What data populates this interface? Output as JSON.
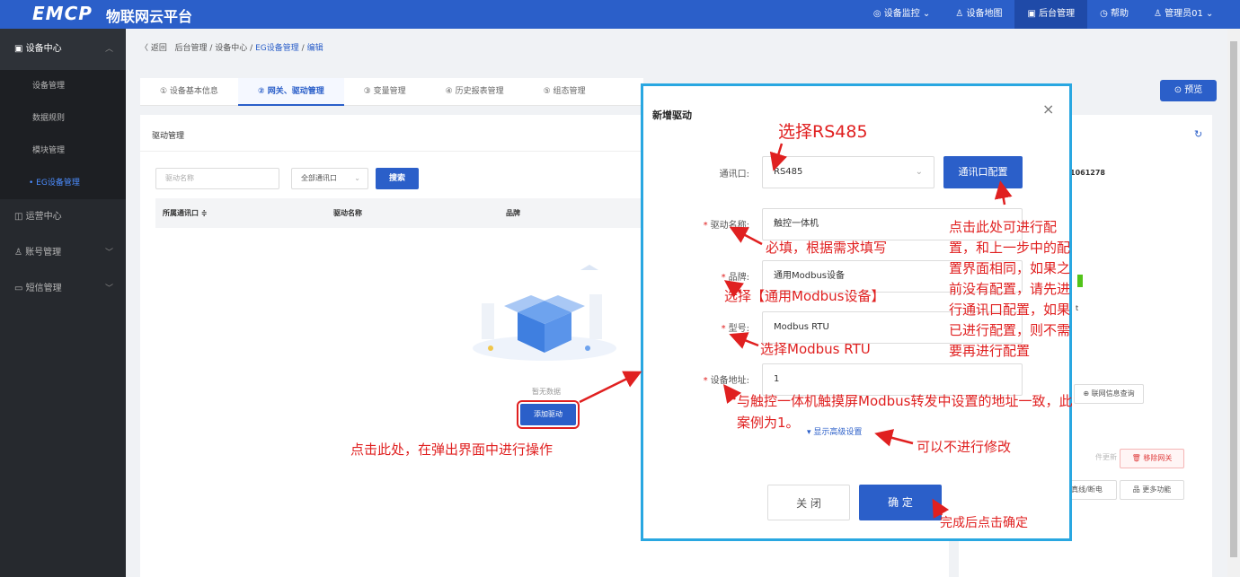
{
  "topbar": {
    "logo": "EMCP",
    "platform": "物联网云平台",
    "nav": [
      {
        "label": "◎ 设备监控 ⌄",
        "active": false
      },
      {
        "label": "♙ 设备地图",
        "active": false
      },
      {
        "label": "▣ 后台管理",
        "active": true
      },
      {
        "label": "◷ 帮助",
        "active": false
      },
      {
        "label": "♙ 管理员01 ⌄",
        "active": false
      }
    ]
  },
  "sidebar": {
    "group": "设备中心",
    "subs": [
      "设备管理",
      "数据规则",
      "模块管理",
      "• EG设备管理"
    ],
    "items": [
      "运营中心",
      "账号管理",
      "短信管理"
    ]
  },
  "breadcrumb": {
    "back": "〈 返回",
    "path1": "后台管理",
    "sep": "/",
    "path2": "设备中心",
    "path3": "EG设备管理",
    "path4": "编辑"
  },
  "tabs": [
    "① 设备基本信息",
    "② 网关、驱动管理",
    "③ 变量管理",
    "④ 历史报表管理",
    "⑤ 组态管理"
  ],
  "preview_button": "⊙ 预览",
  "driver_panel": {
    "title": "驱动管理",
    "driver_name_placeholder": "驱动名称",
    "port_select": "全部通讯口",
    "search_button": "搜索",
    "columns": [
      "所属通讯口 ≑",
      "驱动名称",
      "品牌"
    ],
    "empty_text": "暂无数据",
    "add_button": "添加驱动"
  },
  "right_panel": {
    "device_id_fragment": "1061278",
    "letter": "t",
    "network_query": "⊕ 联网信息查询",
    "firmware_update": "件更新",
    "remove_gateway": "🗑 移除网关",
    "power_fragment": "真线/断电",
    "more_functions": "品 更多功能"
  },
  "modal": {
    "title": "新增驱动",
    "close": "×",
    "port_label": "通讯口:",
    "port_value": "RS485",
    "port_config_button": "通讯口配置",
    "name_label": "驱动名称:",
    "name_value": "触控一体机",
    "brand_label": "品牌:",
    "brand_value": "通用Modbus设备",
    "model_label": "型号:",
    "model_value": "Modbus RTU",
    "addr_label": "设备地址:",
    "addr_value": "1",
    "advanced": "▾ 显示高级设置",
    "close_button": "关 闭",
    "ok_button": "确 定"
  },
  "annotations": {
    "select_rs485": "选择RS485",
    "required": "必填，根据需求填写",
    "select_brand": "选择【通用Modbus设备】",
    "select_model": "选择Modbus RTU",
    "addr_note_1": "与触控一体机触摸屏Modbus转发中设置的地址一致，此",
    "addr_note_2": "案例为1。",
    "no_modify": "可以不进行修改",
    "click_here": "点击此处，在弹出界面中进行操作",
    "finish": "完成后点击确定",
    "config_note": [
      "点击此处可进行配",
      "置，和上一步中的配",
      "置界面相同，如果之",
      "前没有配置，请先进",
      "行通讯口配置，如果",
      "已进行配置，则不需",
      "要再进行配置"
    ]
  }
}
